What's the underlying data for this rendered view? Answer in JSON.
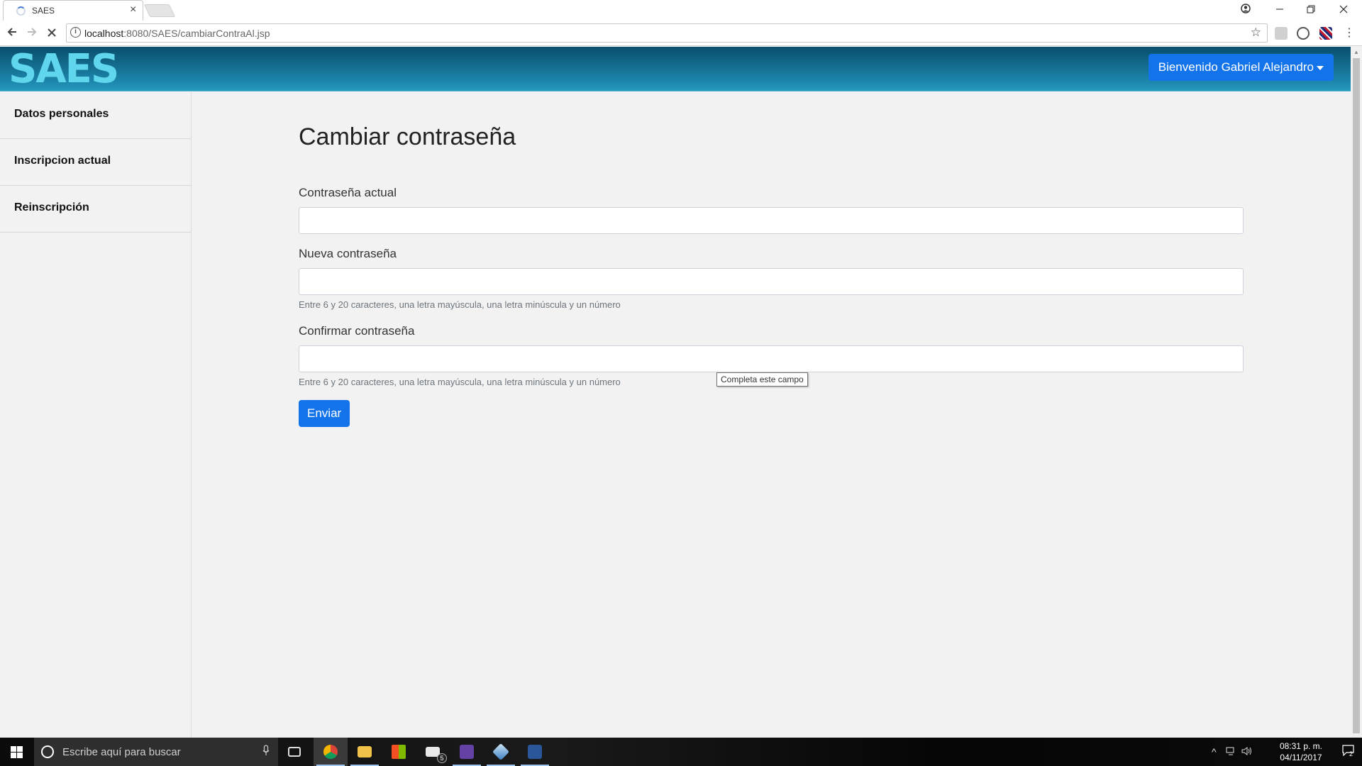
{
  "browser": {
    "tab_title": "SAES",
    "tab_close": "×",
    "url_host": "localhost",
    "url_path": ":8080/SAES/cambiarContraAl.jsp"
  },
  "header": {
    "logo": "SAES",
    "user_menu": "Bienvenido Gabriel Alejandro"
  },
  "sidebar": {
    "items": [
      {
        "label": "Datos personales"
      },
      {
        "label": "Inscripcion actual"
      },
      {
        "label": "Reinscripción"
      }
    ]
  },
  "form": {
    "title": "Cambiar contraseña",
    "fields": [
      {
        "label": "Contraseña actual",
        "value": "",
        "help": ""
      },
      {
        "label": "Nueva contraseña",
        "value": "",
        "help": "Entre 6 y 20 caracteres, una letra mayúscula, una letra minúscula y un número"
      },
      {
        "label": "Confirmar contraseña",
        "value": "",
        "help": "Entre 6 y 20 caracteres, una letra mayúscula, una letra minúscula y un número"
      }
    ],
    "validation_tooltip": "Completa este campo",
    "submit_label": "Enviar"
  },
  "taskbar": {
    "search_placeholder": "Escribe aquí para buscar",
    "mail_badge": "5",
    "time": "08:31 p. m.",
    "date": "04/11/2017",
    "notification_count": "2"
  },
  "colors": {
    "header_gradient_top": "#0a4e6c",
    "header_gradient_bottom": "#2598be",
    "logo": "#5fd6ec",
    "primary_button": "#1273ea"
  }
}
